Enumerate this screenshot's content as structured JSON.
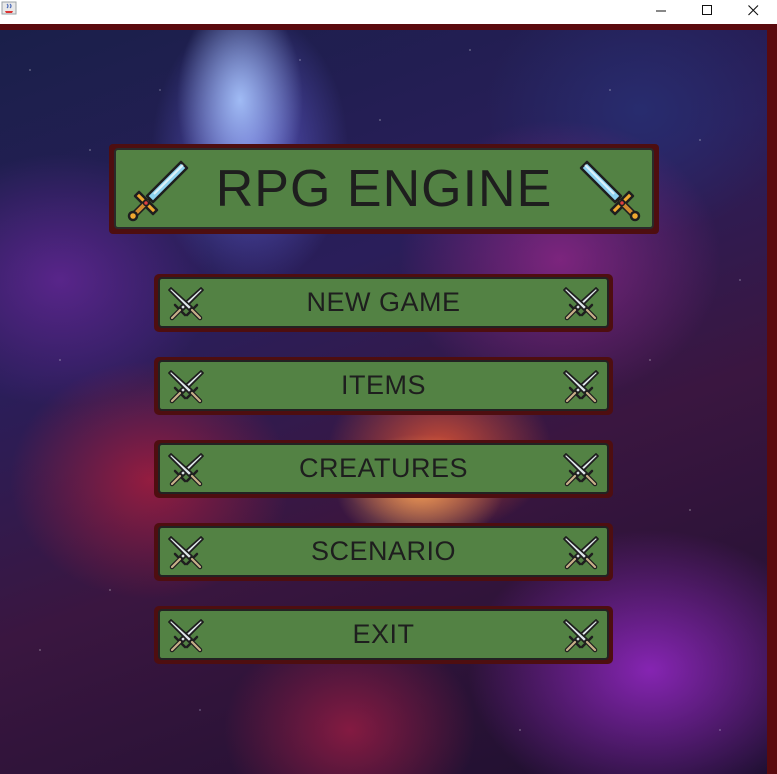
{
  "window": {
    "icon": "java-cup-icon",
    "controls": [
      "minimize-icon",
      "maximize-icon",
      "close-icon"
    ]
  },
  "game": {
    "title": "RPG ENGINE",
    "title_icon": "sword-icon",
    "menu": [
      {
        "label": "NEW GAME",
        "icon": "crossed-swords-icon"
      },
      {
        "label": "ITEMS",
        "icon": "crossed-swords-icon"
      },
      {
        "label": "CREATURES",
        "icon": "crossed-swords-icon"
      },
      {
        "label": "SCENARIO",
        "icon": "crossed-swords-icon"
      },
      {
        "label": "EXIT",
        "icon": "crossed-swords-icon"
      }
    ]
  },
  "colors": {
    "button_fill": "#538244",
    "button_border": "#4e0e10",
    "frame": "#5a0a0e",
    "text": "#1e1e1e"
  }
}
